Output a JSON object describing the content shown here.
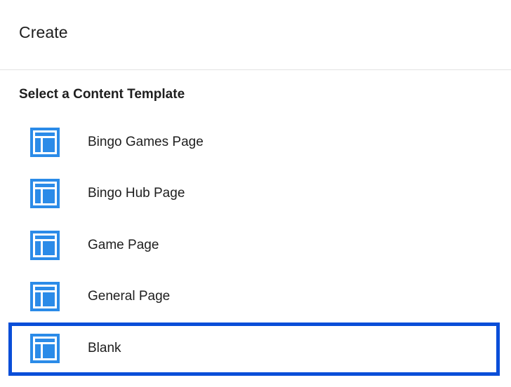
{
  "header": {
    "title": "Create"
  },
  "section": {
    "title": "Select a Content Template"
  },
  "templates": [
    {
      "label": "Bingo Games Page",
      "icon": "template-layout-icon",
      "selected": false
    },
    {
      "label": "Bingo Hub Page",
      "icon": "template-layout-icon",
      "selected": false
    },
    {
      "label": "Game Page",
      "icon": "template-layout-icon",
      "selected": false
    },
    {
      "label": "General Page",
      "icon": "template-layout-icon",
      "selected": false
    },
    {
      "label": "Blank",
      "icon": "template-layout-icon",
      "selected": true
    }
  ],
  "colors": {
    "icon": "#2b8be8",
    "selection": "#0a4ed8"
  }
}
